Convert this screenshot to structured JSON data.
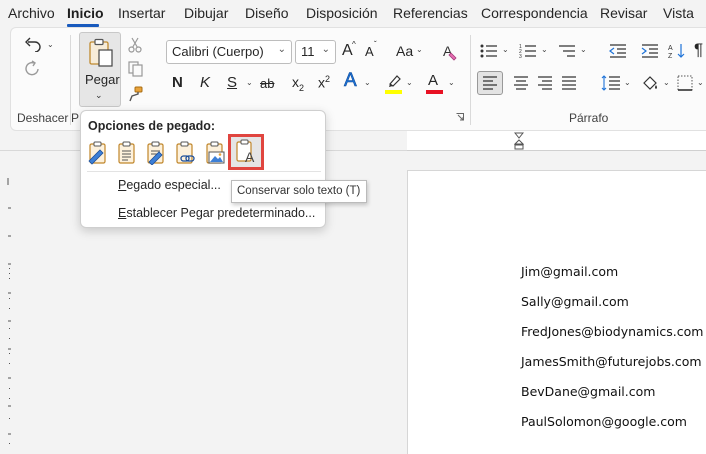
{
  "menu": {
    "tabs": [
      {
        "label": "Archivo"
      },
      {
        "label": "Inicio"
      },
      {
        "label": "Insertar"
      },
      {
        "label": "Dibujar"
      },
      {
        "label": "Diseño"
      },
      {
        "label": "Disposición"
      },
      {
        "label": "Referencias"
      },
      {
        "label": "Correspondencia"
      },
      {
        "label": "Revisar"
      },
      {
        "label": "Vista"
      }
    ],
    "active_tab": "Inicio"
  },
  "ribbon": {
    "undo_group_label": "Deshacer",
    "clipboard_group_label_partial": "P",
    "paragraph_group_label": "Párrafo",
    "paste_label": "Pegar",
    "font_name": "Calibri (Cuerpo)",
    "font_size": "11",
    "grow_font": "A",
    "shrink_font": "A",
    "change_case": "Aa",
    "bold": "N",
    "italic": "K",
    "underline": "S",
    "strikethrough": "ab",
    "subscript_base": "x",
    "subscript_mark": "2",
    "superscript_base": "x",
    "superscript_mark": "2",
    "text_effects": "A",
    "font_color_glyph": "A",
    "pilcrow": "¶",
    "colors": {
      "highlight": "#ffff00",
      "font_color": "#e81123",
      "accent": "#185abd"
    }
  },
  "paste_popup": {
    "title": "Opciones de pegado:",
    "options": [
      {
        "icon": "keep-source-formatting-icon"
      },
      {
        "icon": "merge-formatting-icon"
      },
      {
        "icon": "use-destination-styles-icon"
      },
      {
        "icon": "link-keep-source-icon"
      },
      {
        "icon": "paste-as-picture-icon"
      },
      {
        "icon": "keep-text-only-icon"
      }
    ],
    "items": [
      {
        "accel": "P",
        "rest": "egado especial..."
      },
      {
        "accel": "E",
        "rest": "stablecer Pegar predeterminado..."
      }
    ]
  },
  "tooltip": "Conservar solo texto (T)",
  "document": {
    "lines": [
      "Jim@gmail.com",
      "Sally@gmail.com",
      "FredJones@biodynamics.com",
      "JamesSmith@futurejobs.com",
      "BevDane@gmail.com",
      "PaulSolomon@google.com"
    ]
  }
}
